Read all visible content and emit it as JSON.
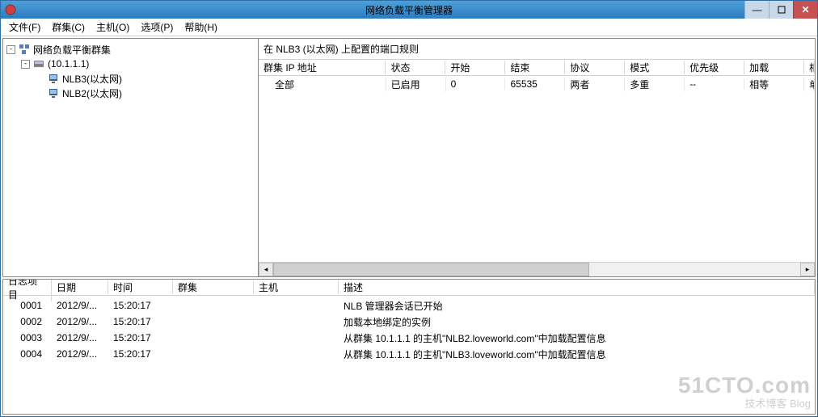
{
  "window": {
    "title": "网络负载平衡管理器"
  },
  "menu": {
    "file": "文件(F)",
    "cluster": "群集(C)",
    "host": "主机(O)",
    "options": "选项(P)",
    "help": "帮助(H)"
  },
  "tree": {
    "root": "网络负载平衡群集",
    "cluster": "(10.1.1.1)",
    "host1": "NLB3(以太网)",
    "host2": "NLB2(以太网)"
  },
  "rules": {
    "caption": "在 NLB3 (以太网) 上配置的端口规则",
    "headers": {
      "ip": "群集 IP 地址",
      "status": "状态",
      "start": "开始",
      "end": "结束",
      "protocol": "协议",
      "mode": "模式",
      "priority": "优先级",
      "load": "加载",
      "affinity": "相关"
    },
    "row": {
      "ip": "全部",
      "status": "已启用",
      "start": "0",
      "end": "65535",
      "protocol": "两者",
      "mode": "多重",
      "priority": "--",
      "load": "相等",
      "affinity": "单一"
    }
  },
  "log": {
    "headers": {
      "item": "日志项目",
      "date": "日期",
      "time": "时间",
      "cluster": "群集",
      "host": "主机",
      "desc": "描述"
    },
    "rows": [
      {
        "item": "0001",
        "date": "2012/9/...",
        "time": "15:20:17",
        "cluster": "",
        "host": "",
        "desc": "NLB 管理器会话已开始"
      },
      {
        "item": "0002",
        "date": "2012/9/...",
        "time": "15:20:17",
        "cluster": "",
        "host": "",
        "desc": "加载本地绑定的实例"
      },
      {
        "item": "0003",
        "date": "2012/9/...",
        "time": "15:20:17",
        "cluster": "",
        "host": "",
        "desc": "从群集 10.1.1.1 的主机\"NLB2.loveworld.com\"中加载配置信息"
      },
      {
        "item": "0004",
        "date": "2012/9/...",
        "time": "15:20:17",
        "cluster": "",
        "host": "",
        "desc": "从群集 10.1.1.1 的主机\"NLB3.loveworld.com\"中加载配置信息"
      }
    ]
  },
  "watermark": {
    "big": "51CTO.com",
    "small": "技术博客  Blog"
  }
}
